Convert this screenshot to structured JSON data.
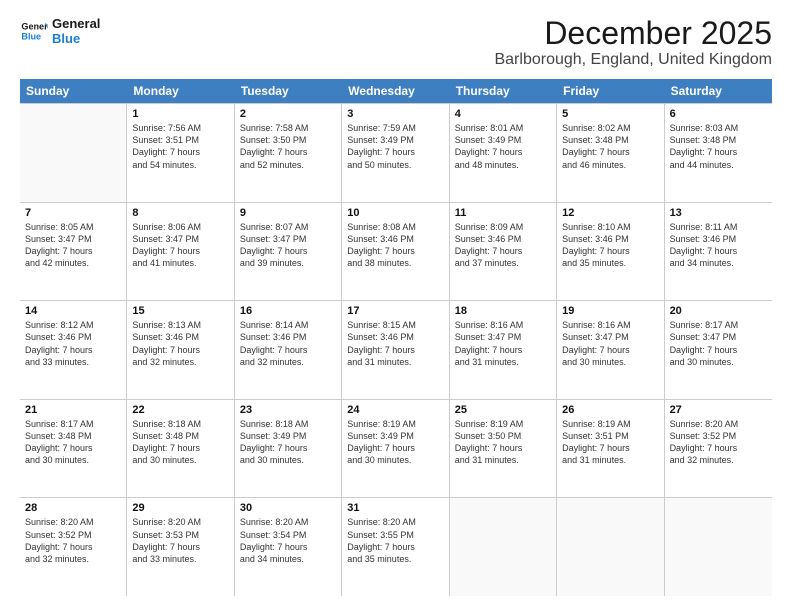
{
  "logo": {
    "line1": "General",
    "line2": "Blue"
  },
  "title": "December 2025",
  "subtitle": "Barlborough, England, United Kingdom",
  "days": [
    "Sunday",
    "Monday",
    "Tuesday",
    "Wednesday",
    "Thursday",
    "Friday",
    "Saturday"
  ],
  "weeks": [
    [
      {
        "day": "",
        "sunrise": "",
        "sunset": "",
        "daylight": ""
      },
      {
        "day": "1",
        "sunrise": "Sunrise: 7:56 AM",
        "sunset": "Sunset: 3:51 PM",
        "daylight1": "Daylight: 7 hours",
        "daylight2": "and 54 minutes."
      },
      {
        "day": "2",
        "sunrise": "Sunrise: 7:58 AM",
        "sunset": "Sunset: 3:50 PM",
        "daylight1": "Daylight: 7 hours",
        "daylight2": "and 52 minutes."
      },
      {
        "day": "3",
        "sunrise": "Sunrise: 7:59 AM",
        "sunset": "Sunset: 3:49 PM",
        "daylight1": "Daylight: 7 hours",
        "daylight2": "and 50 minutes."
      },
      {
        "day": "4",
        "sunrise": "Sunrise: 8:01 AM",
        "sunset": "Sunset: 3:49 PM",
        "daylight1": "Daylight: 7 hours",
        "daylight2": "and 48 minutes."
      },
      {
        "day": "5",
        "sunrise": "Sunrise: 8:02 AM",
        "sunset": "Sunset: 3:48 PM",
        "daylight1": "Daylight: 7 hours",
        "daylight2": "and 46 minutes."
      },
      {
        "day": "6",
        "sunrise": "Sunrise: 8:03 AM",
        "sunset": "Sunset: 3:48 PM",
        "daylight1": "Daylight: 7 hours",
        "daylight2": "and 44 minutes."
      }
    ],
    [
      {
        "day": "7",
        "sunrise": "Sunrise: 8:05 AM",
        "sunset": "Sunset: 3:47 PM",
        "daylight1": "Daylight: 7 hours",
        "daylight2": "and 42 minutes."
      },
      {
        "day": "8",
        "sunrise": "Sunrise: 8:06 AM",
        "sunset": "Sunset: 3:47 PM",
        "daylight1": "Daylight: 7 hours",
        "daylight2": "and 41 minutes."
      },
      {
        "day": "9",
        "sunrise": "Sunrise: 8:07 AM",
        "sunset": "Sunset: 3:47 PM",
        "daylight1": "Daylight: 7 hours",
        "daylight2": "and 39 minutes."
      },
      {
        "day": "10",
        "sunrise": "Sunrise: 8:08 AM",
        "sunset": "Sunset: 3:46 PM",
        "daylight1": "Daylight: 7 hours",
        "daylight2": "and 38 minutes."
      },
      {
        "day": "11",
        "sunrise": "Sunrise: 8:09 AM",
        "sunset": "Sunset: 3:46 PM",
        "daylight1": "Daylight: 7 hours",
        "daylight2": "and 37 minutes."
      },
      {
        "day": "12",
        "sunrise": "Sunrise: 8:10 AM",
        "sunset": "Sunset: 3:46 PM",
        "daylight1": "Daylight: 7 hours",
        "daylight2": "and 35 minutes."
      },
      {
        "day": "13",
        "sunrise": "Sunrise: 8:11 AM",
        "sunset": "Sunset: 3:46 PM",
        "daylight1": "Daylight: 7 hours",
        "daylight2": "and 34 minutes."
      }
    ],
    [
      {
        "day": "14",
        "sunrise": "Sunrise: 8:12 AM",
        "sunset": "Sunset: 3:46 PM",
        "daylight1": "Daylight: 7 hours",
        "daylight2": "and 33 minutes."
      },
      {
        "day": "15",
        "sunrise": "Sunrise: 8:13 AM",
        "sunset": "Sunset: 3:46 PM",
        "daylight1": "Daylight: 7 hours",
        "daylight2": "and 32 minutes."
      },
      {
        "day": "16",
        "sunrise": "Sunrise: 8:14 AM",
        "sunset": "Sunset: 3:46 PM",
        "daylight1": "Daylight: 7 hours",
        "daylight2": "and 32 minutes."
      },
      {
        "day": "17",
        "sunrise": "Sunrise: 8:15 AM",
        "sunset": "Sunset: 3:46 PM",
        "daylight1": "Daylight: 7 hours",
        "daylight2": "and 31 minutes."
      },
      {
        "day": "18",
        "sunrise": "Sunrise: 8:16 AM",
        "sunset": "Sunset: 3:47 PM",
        "daylight1": "Daylight: 7 hours",
        "daylight2": "and 31 minutes."
      },
      {
        "day": "19",
        "sunrise": "Sunrise: 8:16 AM",
        "sunset": "Sunset: 3:47 PM",
        "daylight1": "Daylight: 7 hours",
        "daylight2": "and 30 minutes."
      },
      {
        "day": "20",
        "sunrise": "Sunrise: 8:17 AM",
        "sunset": "Sunset: 3:47 PM",
        "daylight1": "Daylight: 7 hours",
        "daylight2": "and 30 minutes."
      }
    ],
    [
      {
        "day": "21",
        "sunrise": "Sunrise: 8:17 AM",
        "sunset": "Sunset: 3:48 PM",
        "daylight1": "Daylight: 7 hours",
        "daylight2": "and 30 minutes."
      },
      {
        "day": "22",
        "sunrise": "Sunrise: 8:18 AM",
        "sunset": "Sunset: 3:48 PM",
        "daylight1": "Daylight: 7 hours",
        "daylight2": "and 30 minutes."
      },
      {
        "day": "23",
        "sunrise": "Sunrise: 8:18 AM",
        "sunset": "Sunset: 3:49 PM",
        "daylight1": "Daylight: 7 hours",
        "daylight2": "and 30 minutes."
      },
      {
        "day": "24",
        "sunrise": "Sunrise: 8:19 AM",
        "sunset": "Sunset: 3:49 PM",
        "daylight1": "Daylight: 7 hours",
        "daylight2": "and 30 minutes."
      },
      {
        "day": "25",
        "sunrise": "Sunrise: 8:19 AM",
        "sunset": "Sunset: 3:50 PM",
        "daylight1": "Daylight: 7 hours",
        "daylight2": "and 31 minutes."
      },
      {
        "day": "26",
        "sunrise": "Sunrise: 8:19 AM",
        "sunset": "Sunset: 3:51 PM",
        "daylight1": "Daylight: 7 hours",
        "daylight2": "and 31 minutes."
      },
      {
        "day": "27",
        "sunrise": "Sunrise: 8:20 AM",
        "sunset": "Sunset: 3:52 PM",
        "daylight1": "Daylight: 7 hours",
        "daylight2": "and 32 minutes."
      }
    ],
    [
      {
        "day": "28",
        "sunrise": "Sunrise: 8:20 AM",
        "sunset": "Sunset: 3:52 PM",
        "daylight1": "Daylight: 7 hours",
        "daylight2": "and 32 minutes."
      },
      {
        "day": "29",
        "sunrise": "Sunrise: 8:20 AM",
        "sunset": "Sunset: 3:53 PM",
        "daylight1": "Daylight: 7 hours",
        "daylight2": "and 33 minutes."
      },
      {
        "day": "30",
        "sunrise": "Sunrise: 8:20 AM",
        "sunset": "Sunset: 3:54 PM",
        "daylight1": "Daylight: 7 hours",
        "daylight2": "and 34 minutes."
      },
      {
        "day": "31",
        "sunrise": "Sunrise: 8:20 AM",
        "sunset": "Sunset: 3:55 PM",
        "daylight1": "Daylight: 7 hours",
        "daylight2": "and 35 minutes."
      },
      {
        "day": "",
        "sunrise": "",
        "sunset": "",
        "daylight1": "",
        "daylight2": ""
      },
      {
        "day": "",
        "sunrise": "",
        "sunset": "",
        "daylight1": "",
        "daylight2": ""
      },
      {
        "day": "",
        "sunrise": "",
        "sunset": "",
        "daylight1": "",
        "daylight2": ""
      }
    ]
  ]
}
